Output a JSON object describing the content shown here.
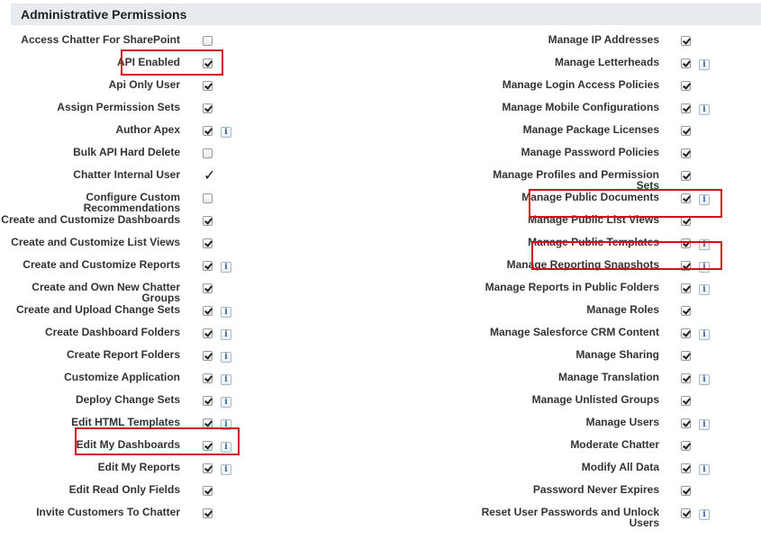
{
  "section": {
    "title": "Administrative Permissions"
  },
  "left_rows": [
    {
      "label": "Access Chatter For SharePoint",
      "checked": false,
      "info": false
    },
    {
      "label": "API Enabled",
      "checked": true,
      "info": false
    },
    {
      "label": "Api Only User",
      "checked": true,
      "info": false
    },
    {
      "label": "Assign Permission Sets",
      "checked": true,
      "info": false
    },
    {
      "label": "Author Apex",
      "checked": true,
      "info": true
    },
    {
      "label": "Bulk API Hard Delete",
      "checked": false,
      "info": false
    },
    {
      "label": "Chatter Internal User",
      "checked": true,
      "info": false,
      "plain": true
    },
    {
      "label": "Configure Custom Recommendations",
      "checked": false,
      "info": false
    },
    {
      "label": "Create and Customize Dashboards",
      "checked": true,
      "info": false
    },
    {
      "label": "Create and Customize List Views",
      "checked": true,
      "info": false
    },
    {
      "label": "Create and Customize Reports",
      "checked": true,
      "info": true
    },
    {
      "label": "Create and Own New Chatter Groups",
      "checked": true,
      "info": false
    },
    {
      "label": "Create and Upload Change Sets",
      "checked": true,
      "info": true
    },
    {
      "label": "Create Dashboard Folders",
      "checked": true,
      "info": true
    },
    {
      "label": "Create Report Folders",
      "checked": true,
      "info": true
    },
    {
      "label": "Customize Application",
      "checked": true,
      "info": true
    },
    {
      "label": "Deploy Change Sets",
      "checked": true,
      "info": true
    },
    {
      "label": "Edit HTML Templates",
      "checked": true,
      "info": true
    },
    {
      "label": "Edit My Dashboards",
      "checked": true,
      "info": true
    },
    {
      "label": "Edit My Reports",
      "checked": true,
      "info": true
    },
    {
      "label": "Edit Read Only Fields",
      "checked": true,
      "info": false
    },
    {
      "label": "Invite Customers To Chatter",
      "checked": true,
      "info": false
    }
  ],
  "right_rows": [
    {
      "label": "Manage IP Addresses",
      "checked": true,
      "info": false
    },
    {
      "label": "Manage Letterheads",
      "checked": true,
      "info": true
    },
    {
      "label": "Manage Login Access Policies",
      "checked": true,
      "info": false
    },
    {
      "label": "Manage Mobile Configurations",
      "checked": true,
      "info": true
    },
    {
      "label": "Manage Package Licenses",
      "checked": true,
      "info": false
    },
    {
      "label": "Manage Password Policies",
      "checked": true,
      "info": false
    },
    {
      "label": "Manage Profiles and Permission Sets",
      "checked": true,
      "info": false
    },
    {
      "label": "Manage Public Documents",
      "checked": true,
      "info": true
    },
    {
      "label": "Manage Public List Views",
      "checked": true,
      "info": false
    },
    {
      "label": "Manage Public Templates",
      "checked": true,
      "info": true
    },
    {
      "label": "Manage Reporting Snapshots",
      "checked": true,
      "info": true
    },
    {
      "label": "Manage Reports in Public Folders",
      "checked": true,
      "info": true
    },
    {
      "label": "Manage Roles",
      "checked": true,
      "info": false
    },
    {
      "label": "Manage Salesforce CRM Content",
      "checked": true,
      "info": true
    },
    {
      "label": "Manage Sharing",
      "checked": true,
      "info": false
    },
    {
      "label": "Manage Translation",
      "checked": true,
      "info": true
    },
    {
      "label": "Manage Unlisted Groups",
      "checked": true,
      "info": false
    },
    {
      "label": "Manage Users",
      "checked": true,
      "info": true
    },
    {
      "label": "Moderate Chatter",
      "checked": true,
      "info": false
    },
    {
      "label": "Modify All Data",
      "checked": true,
      "info": true
    },
    {
      "label": "Password Never Expires",
      "checked": true,
      "info": false
    },
    {
      "label": "Reset User Passwords and Unlock Users",
      "checked": true,
      "info": true
    }
  ],
  "info_glyph": "i",
  "highlight_color": "#d0121b"
}
